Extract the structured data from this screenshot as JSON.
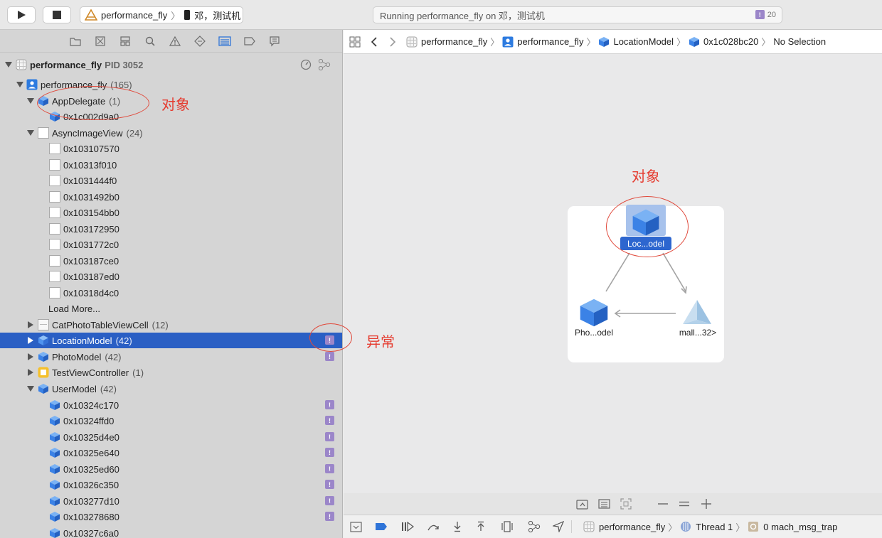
{
  "toolbar": {
    "scheme_app": "performance_fly",
    "scheme_device": "邓，测试机",
    "status_text": "Running performance_fly on 邓，测试机",
    "warning_count": "20"
  },
  "process": {
    "name": "performance_fly",
    "pid": "PID 3052"
  },
  "tree": {
    "app_group": {
      "label": "performance_fly",
      "count": "(165)"
    },
    "appdelegate": {
      "label": "AppDelegate",
      "count": "(1)"
    },
    "appdelegate_child": "0x1c002d9a0",
    "asyncimageview": {
      "label": "AsyncImageView",
      "count": "(24)"
    },
    "async_children": [
      "0x103107570",
      "0x10313f010",
      "0x1031444f0",
      "0x1031492b0",
      "0x103154bb0",
      "0x103172950",
      "0x1031772c0",
      "0x103187ce0",
      "0x103187ed0",
      "0x10318d4c0"
    ],
    "load_more": "Load More...",
    "catphoto": {
      "label": "CatPhotoTableViewCell",
      "count": "(12)"
    },
    "locationmodel": {
      "label": "LocationModel",
      "count": "(42)"
    },
    "photomodel": {
      "label": "PhotoModel",
      "count": "(42)"
    },
    "testvc": {
      "label": "TestViewController",
      "count": "(1)"
    },
    "usermodel": {
      "label": "UserModel",
      "count": "(42)"
    },
    "user_children": [
      "0x10324c170",
      "0x10324ffd0",
      "0x10325d4e0",
      "0x10325e640",
      "0x10325ed60",
      "0x10326c350",
      "0x103277d10",
      "0x103278680",
      "0x10327c6a0"
    ]
  },
  "jumpbar": {
    "project": "performance_fly",
    "target": "performance_fly",
    "class": "LocationModel",
    "address": "0x1c028bc20",
    "selection": "No Selection"
  },
  "graph": {
    "top_label": "Loc...odel",
    "left_label": "Pho...odel",
    "right_label": "mall...32>"
  },
  "debugbar": {
    "app": "performance_fly",
    "thread": "Thread 1",
    "frame": "0 mach_msg_trap"
  },
  "annotations": {
    "object_left": "对象",
    "object_graph": "对象",
    "anomaly": "异常"
  },
  "colors": {
    "selection": "#2a5fc4",
    "badge": "#9b86c9",
    "cube": "#3b82e6",
    "annotation": "#e53b2f"
  }
}
